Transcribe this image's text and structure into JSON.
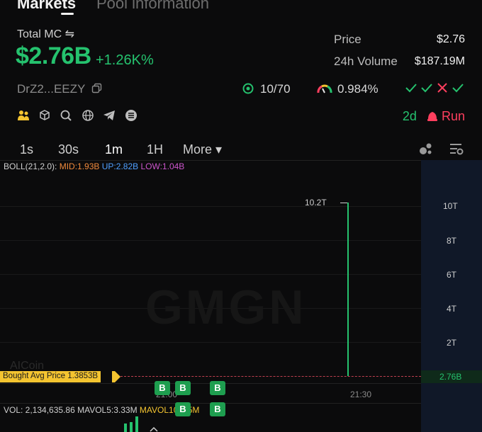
{
  "tabs": [
    "Markets",
    "Pool information"
  ],
  "total_mc_label": "Total MC ⇋",
  "total_mc": "$2.76B",
  "mc_change": "+1.26K%",
  "ticker": "DrZ2...EEZY",
  "stats": {
    "price_label": "Price",
    "price": "$2.76",
    "volume_label": "24h Volume",
    "volume": "$187.19M"
  },
  "holder_ratio": "10/70",
  "rate": "0.984%",
  "run_days": "2d",
  "run_label": "Run",
  "intervals": [
    "1s",
    "30s",
    "1m",
    "1H",
    "More ▾"
  ],
  "boll": {
    "prefix": "BOLL(21,2.0):",
    "mid": "MID:1.93B",
    "up": "UP:2.82B",
    "low": "LOW:1.04B"
  },
  "price_axis": [
    "10T",
    "8T",
    "6T",
    "4T",
    "2T"
  ],
  "peak_label": "10.2T",
  "watermark": "GMGN",
  "aicoin": "AICoin",
  "avg_price_tag": "Bought Avg Price 1.3853B",
  "current_price_tag": "2.76B",
  "time_labels": [
    "21:00",
    "21:30"
  ],
  "badge_label": "B",
  "volume_row": {
    "vol": "VOL: 2,134,635.86",
    "mavol5": "MAVOL5:3.33M",
    "mavol10": "MAVOL10:3.5M"
  },
  "colors": {
    "green": "#25c26e",
    "red": "#ff3f5e",
    "gold": "#f4c430",
    "axis_bg": "#101828"
  }
}
